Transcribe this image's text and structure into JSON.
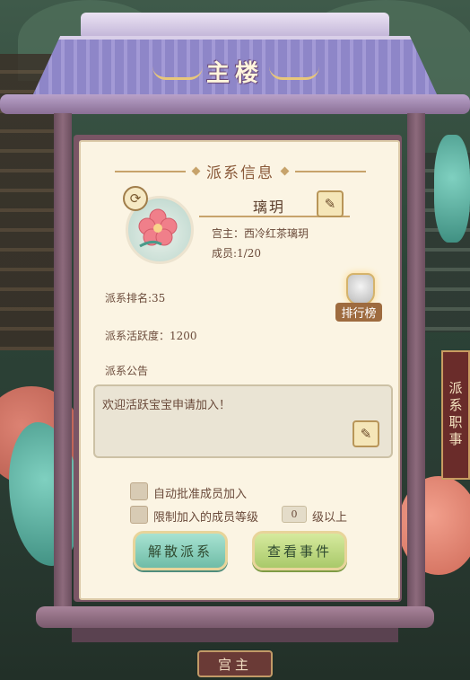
{
  "header": {
    "title": "主楼"
  },
  "section": {
    "title": "派系信息"
  },
  "faction": {
    "name": "璃玥",
    "leader": "宫主：西冷红茶璃玥",
    "members": "成员:1/20",
    "rank": "派系排名:35",
    "activity": "派系活跃度：1200",
    "notice_label": "派系公告",
    "notice_text": "欢迎活跃宝宝申请加入！"
  },
  "ranking_button": {
    "label": "排行榜"
  },
  "options": {
    "auto_approve": "自动批准成员加入",
    "level_limit_prefix": "限制加入的成员等级",
    "level_value": "0",
    "level_limit_suffix": "级以上"
  },
  "buttons": {
    "disband": "解散派系",
    "events": "查看事件"
  },
  "bottom_nav": {
    "tab": "宫主"
  },
  "background": {
    "right_sign": "派系职事"
  },
  "icons": {
    "refresh": "refresh-icon",
    "edit": "pencil-icon",
    "ranking": "trophy-shield-icon",
    "avatar": "pink-flower-icon"
  },
  "colors": {
    "panel": "#fbf4e3",
    "roof": "#8e86c8",
    "accent_gold": "#c7a36b",
    "teal_button": "#6fbca7",
    "green_button": "#a9c96a"
  }
}
